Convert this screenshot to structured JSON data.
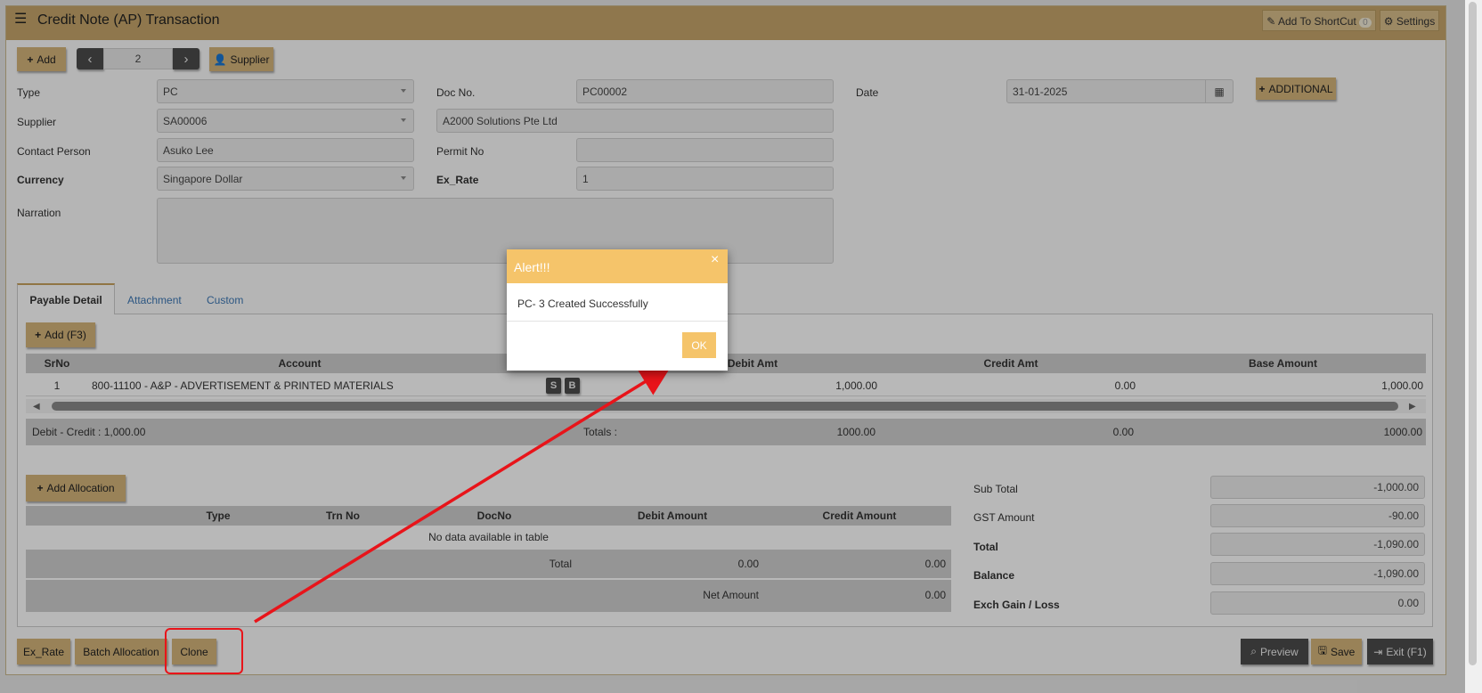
{
  "header": {
    "title": "Credit Note (AP) Transaction",
    "shortcut_label": "Add To ShortCut",
    "shortcut_count": "0",
    "settings_label": "Settings"
  },
  "toolbar": {
    "add_label": "Add",
    "record_number": "2",
    "supplier_label": "Supplier"
  },
  "form": {
    "type_label": "Type",
    "type_value": "PC",
    "docno_label": "Doc No.",
    "docno_value": "PC00002",
    "date_label": "Date",
    "date_value": "31-01-2025",
    "additional_label": "ADDITIONAL",
    "supplier_label": "Supplier",
    "supplier_code": "SA00006",
    "supplier_name": "A2000 Solutions Pte Ltd",
    "contact_label": "Contact Person",
    "contact_value": "Asuko Lee",
    "permit_label": "Permit No",
    "permit_value": "",
    "currency_label": "Currency",
    "currency_value": "Singapore Dollar",
    "exrate_label": "Ex_Rate",
    "exrate_value": "1",
    "narration_label": "Narration",
    "narration_value": ""
  },
  "tabs": [
    {
      "label": "Payable Detail"
    },
    {
      "label": "Attachment"
    },
    {
      "label": "Custom"
    }
  ],
  "detail": {
    "add_label": "Add (F3)",
    "columns": [
      "SrNo",
      "Account",
      "",
      "Debit Amt",
      "Credit Amt",
      "Base Amount"
    ],
    "rows": [
      {
        "srno": "1",
        "account": "800-11100 - A&P - ADVERTISEMENT & PRINTED MATERIALS",
        "s": "S",
        "b": "B",
        "debit": "1,000.00",
        "credit": "0.00",
        "base": "1,000.00"
      }
    ],
    "debit_credit": "Debit - Credit : 1,000.00",
    "totals_label": "Totals :",
    "total_debit": "1000.00",
    "total_credit": "0.00",
    "total_base": "1000.00"
  },
  "allocation": {
    "add_label": "Add Allocation",
    "columns": [
      "Type",
      "Trn No",
      "DocNo",
      "Debit Amount",
      "Credit Amount"
    ],
    "empty_text": "No data available in table",
    "total_label": "Total",
    "total_debit": "0.00",
    "total_credit": "0.00",
    "net_label": "Net Amount",
    "net_value": "0.00"
  },
  "summary": {
    "subtotal_label": "Sub Total",
    "subtotal_value": "-1,000.00",
    "gst_label": "GST Amount",
    "gst_value": "-90.00",
    "total_label": "Total",
    "total_value": "-1,090.00",
    "balance_label": "Balance",
    "balance_value": "-1,090.00",
    "exch_label": "Exch Gain / Loss",
    "exch_value": "0.00"
  },
  "footer": {
    "exrate_label": "Ex_Rate",
    "batch_label": "Batch Allocation",
    "clone_label": "Clone",
    "preview_label": "Preview",
    "save_label": "Save",
    "exit_label": "Exit (F1)"
  },
  "alert": {
    "title": "Alert!!!",
    "message": "PC- 3 Created Successfully",
    "ok_label": "OK",
    "close": "×"
  },
  "colors": {
    "accent": "#c6a66b",
    "button": "#d4b47a",
    "alert_header": "#f5c46a",
    "annotation": "#e8141a"
  }
}
